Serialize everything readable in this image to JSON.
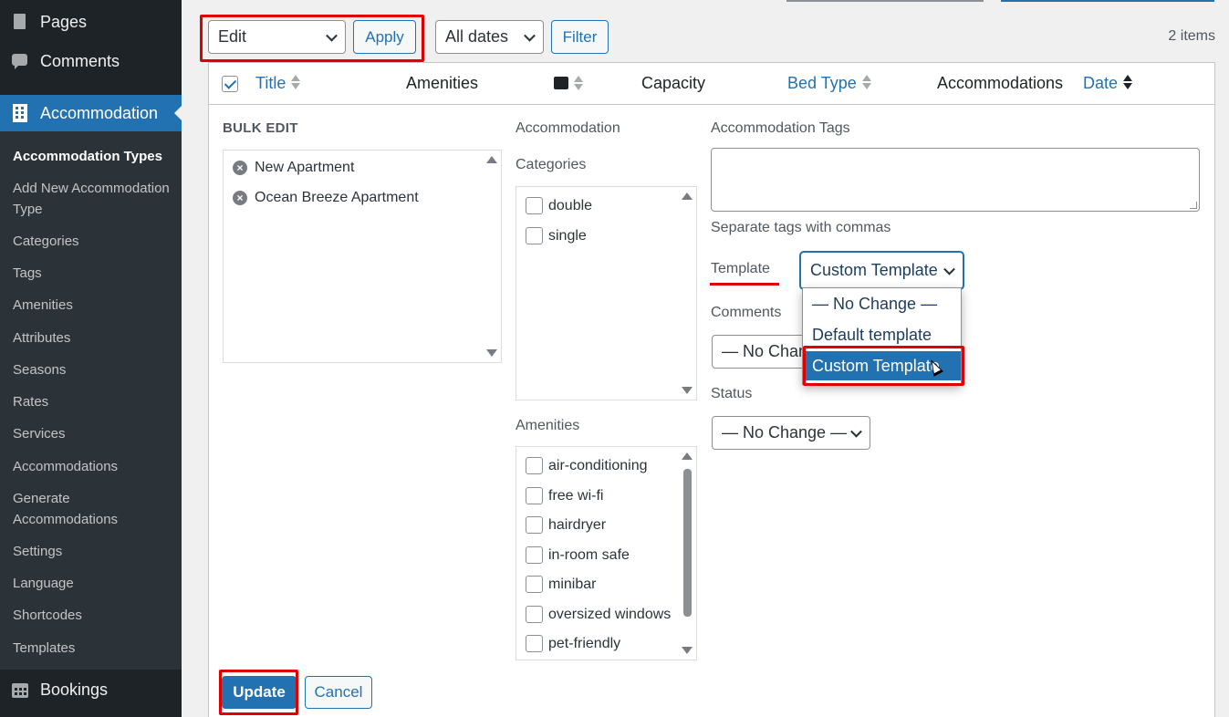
{
  "sidebar": {
    "pages_label": "Pages",
    "comments_label": "Comments",
    "accommodation_label": "Accommodation",
    "bookings_label": "Bookings",
    "items": [
      "Accommodation Types",
      "Add New Accommodation Type",
      "Categories",
      "Tags",
      "Amenities",
      "Attributes",
      "Seasons",
      "Rates",
      "Services",
      "Accommodations",
      "Generate Accommodations",
      "Settings",
      "Language",
      "Shortcodes",
      "Templates"
    ]
  },
  "toolbar": {
    "bulk_action_value": "Edit",
    "apply_label": "Apply",
    "dates_value": "All dates",
    "filter_label": "Filter",
    "items_count": "2 items"
  },
  "columns": {
    "title": "Title",
    "amenities": "Amenities",
    "capacity": "Capacity",
    "bed_type": "Bed Type",
    "accommodations": "Accommodations",
    "date": "Date"
  },
  "bulk_edit": {
    "heading": "BULK EDIT",
    "posts": [
      "New Apartment",
      "Ocean Breeze Apartment"
    ],
    "accommodation_label": "Accommodation",
    "categories_label": "Categories",
    "categories": [
      "double",
      "single"
    ],
    "amenities_label": "Amenities",
    "amenities": [
      "air-conditioning",
      "free wi-fi",
      "hairdryer",
      "in-room safe",
      "minibar",
      "oversized windows",
      "pet-friendly"
    ],
    "tags_label": "Accommodation Tags",
    "tags_hint": "Separate tags with commas",
    "template_label": "Template",
    "template_value": "Custom Template",
    "template_options": [
      "— No Change —",
      "Default template",
      "Custom Template"
    ],
    "comments_label": "Comments",
    "comments_value": "— No Change —",
    "status_label": "Status",
    "status_value": "— No Change —",
    "update_label": "Update",
    "cancel_label": "Cancel"
  },
  "colors": {
    "accent": "#2271b1",
    "highlight": "#e00000",
    "sidebar_bg": "#1d2327"
  }
}
